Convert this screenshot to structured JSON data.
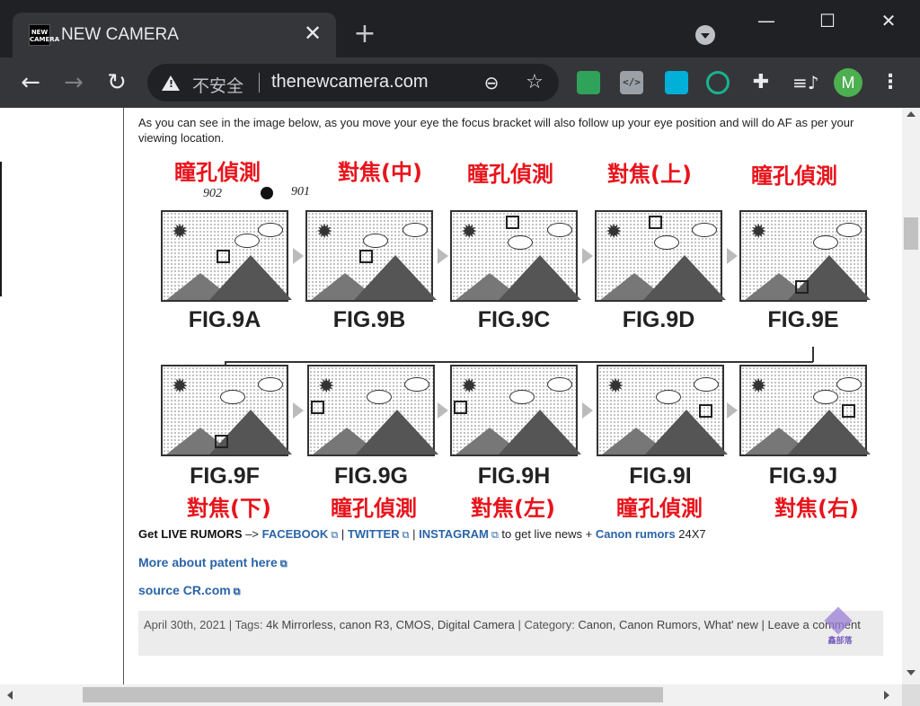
{
  "window": {
    "tab_title": "NEW CAMERA",
    "favicon_text": "NEW CAMERA",
    "tab_close": "✕",
    "new_tab": "+",
    "minimize": "—",
    "maximize": "☐",
    "close": "✕"
  },
  "toolbar": {
    "back": "←",
    "forward": "→",
    "reload": "↻",
    "security_label": "不安全",
    "url": "thenewcamera.com",
    "zoom": "⊖",
    "bookmark": "☆",
    "ext_code": "</>",
    "ext_puzzle": "✚",
    "ext_media": "≡♪",
    "avatar_letter": "M",
    "menu": "⋮"
  },
  "article": {
    "intro": "As you can see in the image below, as you move your eye the focus bracket will also follow up your eye position and will do AF as per your viewing location.",
    "patent_figure": {
      "ref_902": "902",
      "ref_901": "901",
      "top_captions": [
        "瞳孔偵測",
        "對焦(中)",
        "瞳孔偵測",
        "對焦(上)",
        "瞳孔偵測"
      ],
      "top_labels": [
        "FIG.9A",
        "FIG.9B",
        "FIG.9C",
        "FIG.9D",
        "FIG.9E"
      ],
      "bottom_labels": [
        "FIG.9F",
        "FIG.9G",
        "FIG.9H",
        "FIG.9I",
        "FIG.9J"
      ],
      "bottom_captions": [
        "對焦(下)",
        "瞳孔偵測",
        "對焦(左)",
        "瞳孔偵測",
        "對焦(右)"
      ]
    },
    "rumors": {
      "lead": "Get LIVE RUMORS",
      "arrow": " –> ",
      "facebook": "FACEBOOK",
      "sep1": " | ",
      "twitter": "TWITTER",
      "sep2": " |  ",
      "instagram": "INSTAGRAM",
      "mid": " to get live news + ",
      "canon": "Canon rumors",
      "tail": " 24X7"
    },
    "more_patent": "More about patent here",
    "source": "source CR.com",
    "meta": {
      "date": "April 30th, 2021",
      "tags_prefix": " | Tags: ",
      "tags": "4k Mirrorless, canon R3, CMOS, Digital Camera",
      "cat_prefix": " | Category: ",
      "categories": "Canon, Canon Rumors, What' new",
      "leave": " | Leave a comment"
    },
    "watermark_text": "鑫部落"
  }
}
